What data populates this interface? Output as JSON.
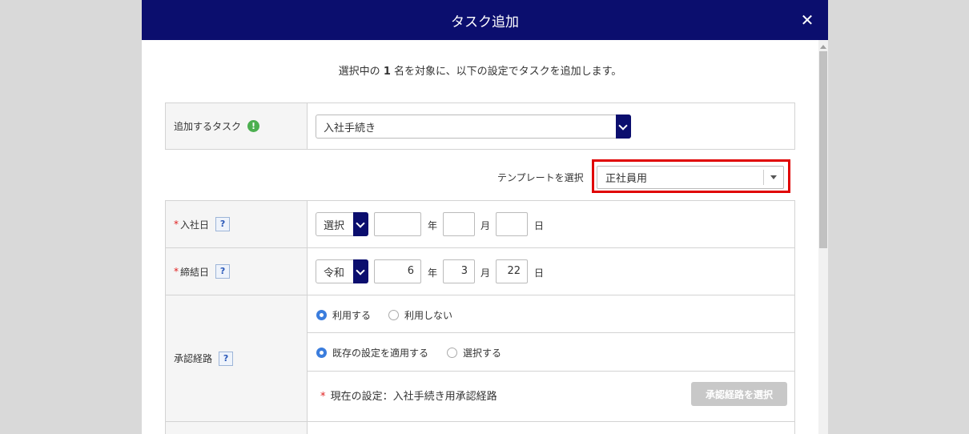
{
  "dialog": {
    "title": "タスク追加",
    "close_label": "✕",
    "intro": {
      "prefix": "選択中の ",
      "count": "1",
      "suffix": " 名を対象に、以下の設定でタスクを追加します。"
    }
  },
  "task_row": {
    "label": "追加するタスク",
    "info_icon": "!",
    "selected": "入社手続き"
  },
  "template": {
    "label": "テンプレートを選択",
    "selected": "正社員用"
  },
  "hire_date": {
    "required_mark": "*",
    "label": "入社日",
    "help": "?",
    "era": "選択",
    "year": "",
    "month": "",
    "day": "",
    "unit_year": "年",
    "unit_month": "月",
    "unit_day": "日"
  },
  "contract_date": {
    "required_mark": "*",
    "label": "締結日",
    "help": "?",
    "era": "令和",
    "year": "6",
    "month": "3",
    "day": "22",
    "unit_year": "年",
    "unit_month": "月",
    "unit_day": "日"
  },
  "approval": {
    "label": "承認経路",
    "help": "?",
    "use_options": [
      {
        "label": "利用する",
        "checked": true
      },
      {
        "label": "利用しない",
        "checked": false
      }
    ],
    "setting_options": [
      {
        "label": "既存の設定を適用する",
        "checked": true
      },
      {
        "label": "選択する",
        "checked": false
      }
    ],
    "current_mark": "*",
    "current_text": "現在の設定：入社手続き用承認経路",
    "select_button": "承認経路を選択"
  },
  "colors": {
    "header": "#0b0e6e",
    "highlight": "#e00000",
    "radio_checked": "#3b7ddd"
  }
}
